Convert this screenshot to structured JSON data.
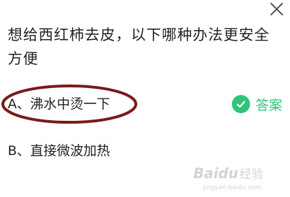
{
  "question": {
    "text": "想给西红柿去皮，以下哪种办法更安全方便"
  },
  "options": [
    {
      "label": "A、沸水中烫一下"
    },
    {
      "label": "B、直接微波加热"
    }
  ],
  "answer": {
    "text": "答案",
    "color": "#2ec47a"
  },
  "highlight": {
    "color": "#7a1a1a"
  },
  "watermark": {
    "text": "Baidu 经验",
    "url": "jingyan.baidu.com"
  },
  "icons": {
    "close": "close-icon",
    "answer": "check-circle-icon"
  }
}
